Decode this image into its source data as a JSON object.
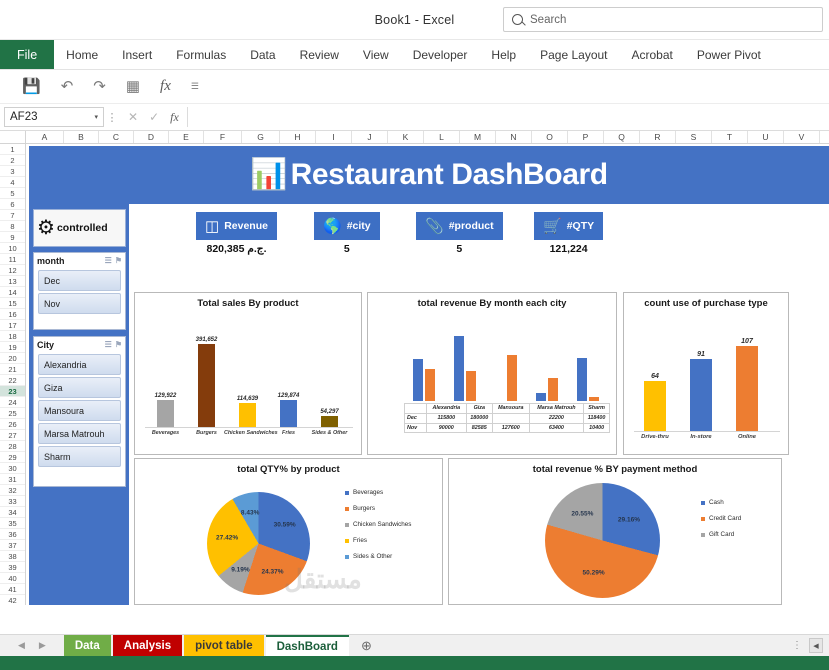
{
  "window": {
    "title": "Book1  -  Excel",
    "search_placeholder": "Search",
    "search_icon": "search-icon"
  },
  "ribbon": {
    "tabs": [
      "File",
      "Home",
      "Insert",
      "Formulas",
      "Data",
      "Review",
      "View",
      "Developer",
      "Help",
      "Page Layout",
      "Acrobat",
      "Power Pivot"
    ]
  },
  "quick_access": {
    "icons": [
      "save-icon",
      "undo-icon",
      "redo-icon",
      "calculator-icon",
      "function-icon",
      "customize-qat-icon"
    ],
    "glyphs": [
      "💾",
      "↶",
      "↷",
      "▦",
      "fx",
      "☰"
    ]
  },
  "formula_bar": {
    "name_box": "AF23",
    "caret": "▾",
    "dots": "⋮",
    "cancel": "✕",
    "confirm": "✓",
    "fx": "fx",
    "value": ""
  },
  "grid": {
    "columns": [
      "A",
      "B",
      "C",
      "D",
      "E",
      "F",
      "G",
      "H",
      "I",
      "J",
      "K",
      "L",
      "M",
      "N",
      "O",
      "P",
      "Q",
      "R",
      "S",
      "T",
      "U",
      "V"
    ],
    "rows": [
      1,
      2,
      3,
      4,
      5,
      6,
      7,
      8,
      9,
      10,
      11,
      12,
      13,
      14,
      15,
      16,
      17,
      18,
      19,
      20,
      21,
      22,
      23,
      24,
      25,
      26,
      27,
      28,
      29,
      30,
      31,
      32,
      33,
      34,
      35,
      36,
      37,
      38,
      39,
      40,
      41,
      42
    ],
    "selected_row": 23
  },
  "dashboard": {
    "banner_title": "Restaurant DashBoard",
    "banner_logo_icon": "people-chart-icon",
    "banner_color": "#4472c4",
    "controls_label": "controlled",
    "controls_icon": "gears-icon",
    "slicers": [
      {
        "name": "month",
        "multiselect_icon": "multi-select-icon",
        "clearfilter_icon": "clear-filter-icon",
        "items": [
          "Dec",
          "Nov"
        ]
      },
      {
        "name": "City",
        "multiselect_icon": "multi-select-icon",
        "clearfilter_icon": "clear-filter-icon",
        "items": [
          "Alexandria",
          "Giza",
          "Mansoura",
          "Marsa Matrouh",
          "Sharm"
        ]
      }
    ],
    "kpis": [
      {
        "label": "Revenue",
        "value": "820,385 ج.م.",
        "icon": "database-icon",
        "glyph": "⛃"
      },
      {
        "label": "#city",
        "value": "5",
        "icon": "globe-icon",
        "glyph": "🌐"
      },
      {
        "label": "#product",
        "value": "5",
        "icon": "paperclip-icon",
        "glyph": "🖇"
      },
      {
        "label": "#QTY",
        "value": "121,224",
        "icon": "cart-icon",
        "glyph": "🛒"
      }
    ]
  },
  "chart_data": [
    {
      "type": "bar",
      "title": "Total sales By product",
      "categories": [
        "Beverages",
        "Burgers",
        "Chicken Sandwiches",
        "Fries",
        "Sides & Other"
      ],
      "values": [
        129922,
        391652,
        114639,
        129874,
        54297
      ],
      "labels": [
        "129,922",
        "391,652",
        "114,639",
        "129,874",
        "54,297"
      ],
      "colors": [
        "#a5a5a5",
        "#843c0c",
        "#ffc000",
        "#4472c4",
        "#7f6000"
      ],
      "ylim": [
        0,
        430000
      ],
      "xlabel": "",
      "ylabel": "",
      "grid": false,
      "legend": "none"
    },
    {
      "type": "bar",
      "title": "total revenue By month each city",
      "categories": [
        "Alexandria",
        "Giza",
        "Mansoura",
        "Marsa Matrouh",
        "Sharm"
      ],
      "series": [
        {
          "name": "Dec",
          "values": [
            115800,
            180000,
            null,
            22200,
            118400
          ],
          "labels": [
            "115800",
            "180000",
            "",
            "22200",
            "118400"
          ],
          "color": "#4472c4"
        },
        {
          "name": "Nov",
          "values": [
            90000,
            82585,
            127600,
            63400,
            10400
          ],
          "labels": [
            "90000",
            "82585",
            "127600",
            "63400",
            "10400"
          ],
          "color": "#ed7d31"
        }
      ],
      "ylim": [
        0,
        200000
      ],
      "data_table": true,
      "xlabel": "",
      "ylabel": "",
      "grid": false,
      "legend": "data-table"
    },
    {
      "type": "bar",
      "title": "count use of purchase type",
      "categories": [
        "Drive-thru",
        "In-store",
        "Online"
      ],
      "values": [
        64,
        91,
        107
      ],
      "labels": [
        "64",
        "91",
        "107"
      ],
      "colors": [
        "#ffc000",
        "#4472c4",
        "#ed7d31"
      ],
      "ylim": [
        0,
        125
      ],
      "xlabel": "",
      "ylabel": "",
      "grid": false,
      "legend": "none"
    },
    {
      "type": "pie",
      "title": "total QTY% by product",
      "categories": [
        "Beverages",
        "Burgers",
        "Chicken Sandwiches",
        "Fries",
        "Sides & Other"
      ],
      "values": [
        30.59,
        24.37,
        9.19,
        27.42,
        8.43
      ],
      "labels": [
        "30.59%",
        "24.37%",
        "9.19%",
        "27.42%",
        "8.43%"
      ],
      "colors": [
        "#4472c4",
        "#ed7d31",
        "#a5a5a5",
        "#ffc000",
        "#5b9bd5"
      ],
      "legend": "right"
    },
    {
      "type": "pie",
      "title": "total revenue % BY payment method",
      "categories": [
        "Cash",
        "Credit Card",
        "Gift Card"
      ],
      "values": [
        29.16,
        50.29,
        20.55
      ],
      "labels": [
        "29.16%",
        "50.29%",
        "20.55%"
      ],
      "colors": [
        "#4472c4",
        "#ed7d31",
        "#a5a5a5"
      ],
      "legend": "right"
    }
  ],
  "sheet_tabs": {
    "prev_icon": "◀",
    "next_icon": "▶",
    "add_icon": "⊕",
    "tabs": [
      {
        "label": "Data",
        "color": "#70ad47",
        "text": "#ffffff",
        "active": false
      },
      {
        "label": "Analysis",
        "color": "#c00000",
        "text": "#ffffff",
        "active": false
      },
      {
        "label": "pivot table",
        "color": "#ffc000",
        "text": "#3a3a3a",
        "active": false
      },
      {
        "label": "DashBoard",
        "color": "#ffffff",
        "text": "#1b5e3a",
        "active": true
      }
    ],
    "options_icon": "⋮",
    "scroll_left_icon": "◀"
  },
  "watermark": "مستقل"
}
